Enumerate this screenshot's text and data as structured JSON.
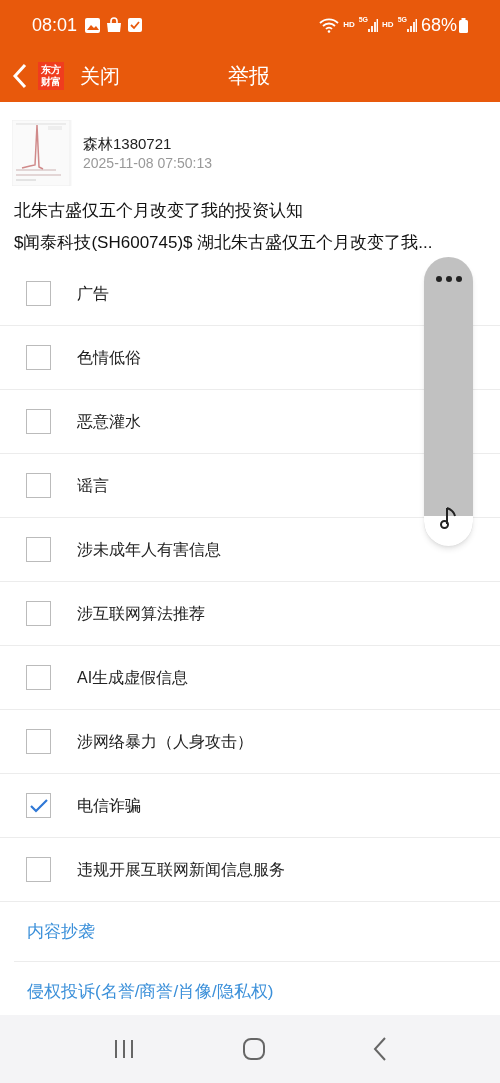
{
  "status_bar": {
    "time": "08:01",
    "network_labels": [
      {
        "hd": "HD",
        "gen": "5G"
      },
      {
        "hd": "HD",
        "gen": "5G"
      }
    ],
    "battery": "68%"
  },
  "header": {
    "logo": [
      "东方",
      "财富"
    ],
    "close": "关闭",
    "title": "举报"
  },
  "post": {
    "kind": "picture",
    "author": "森林1380721",
    "time": "2025-11-08 07:50:13",
    "title": "北朱古盛仅五个月改变了我的投资认知",
    "excerpt": "$闻泰科技(SH600745)$ 湖北朱古盛仅五个月改变了我..."
  },
  "reasons": [
    {
      "kind": "checkbox",
      "label": "广告",
      "checked": false
    },
    {
      "kind": "checkbox",
      "label": "色情低俗",
      "checked": false
    },
    {
      "kind": "checkbox",
      "label": "恶意灌水",
      "checked": false
    },
    {
      "kind": "checkbox",
      "label": "谣言",
      "checked": false
    },
    {
      "kind": "checkbox",
      "label": "涉未成年人有害信息",
      "checked": false
    },
    {
      "kind": "checkbox",
      "label": "涉互联网算法推荐",
      "checked": false
    },
    {
      "kind": "checkbox",
      "label": "AI生成虚假信息",
      "checked": false
    },
    {
      "kind": "checkbox",
      "label": "涉网络暴力（人身攻击）",
      "checked": false
    },
    {
      "kind": "checkbox",
      "label": "电信诈骗",
      "checked": true
    },
    {
      "kind": "checkbox",
      "label": "违规开展互联网新闻信息服务",
      "checked": false
    },
    {
      "kind": "link",
      "label": "内容抄袭"
    },
    {
      "kind": "link",
      "label": "侵权投诉(名誉/商誉/肖像/隐私权)"
    }
  ]
}
